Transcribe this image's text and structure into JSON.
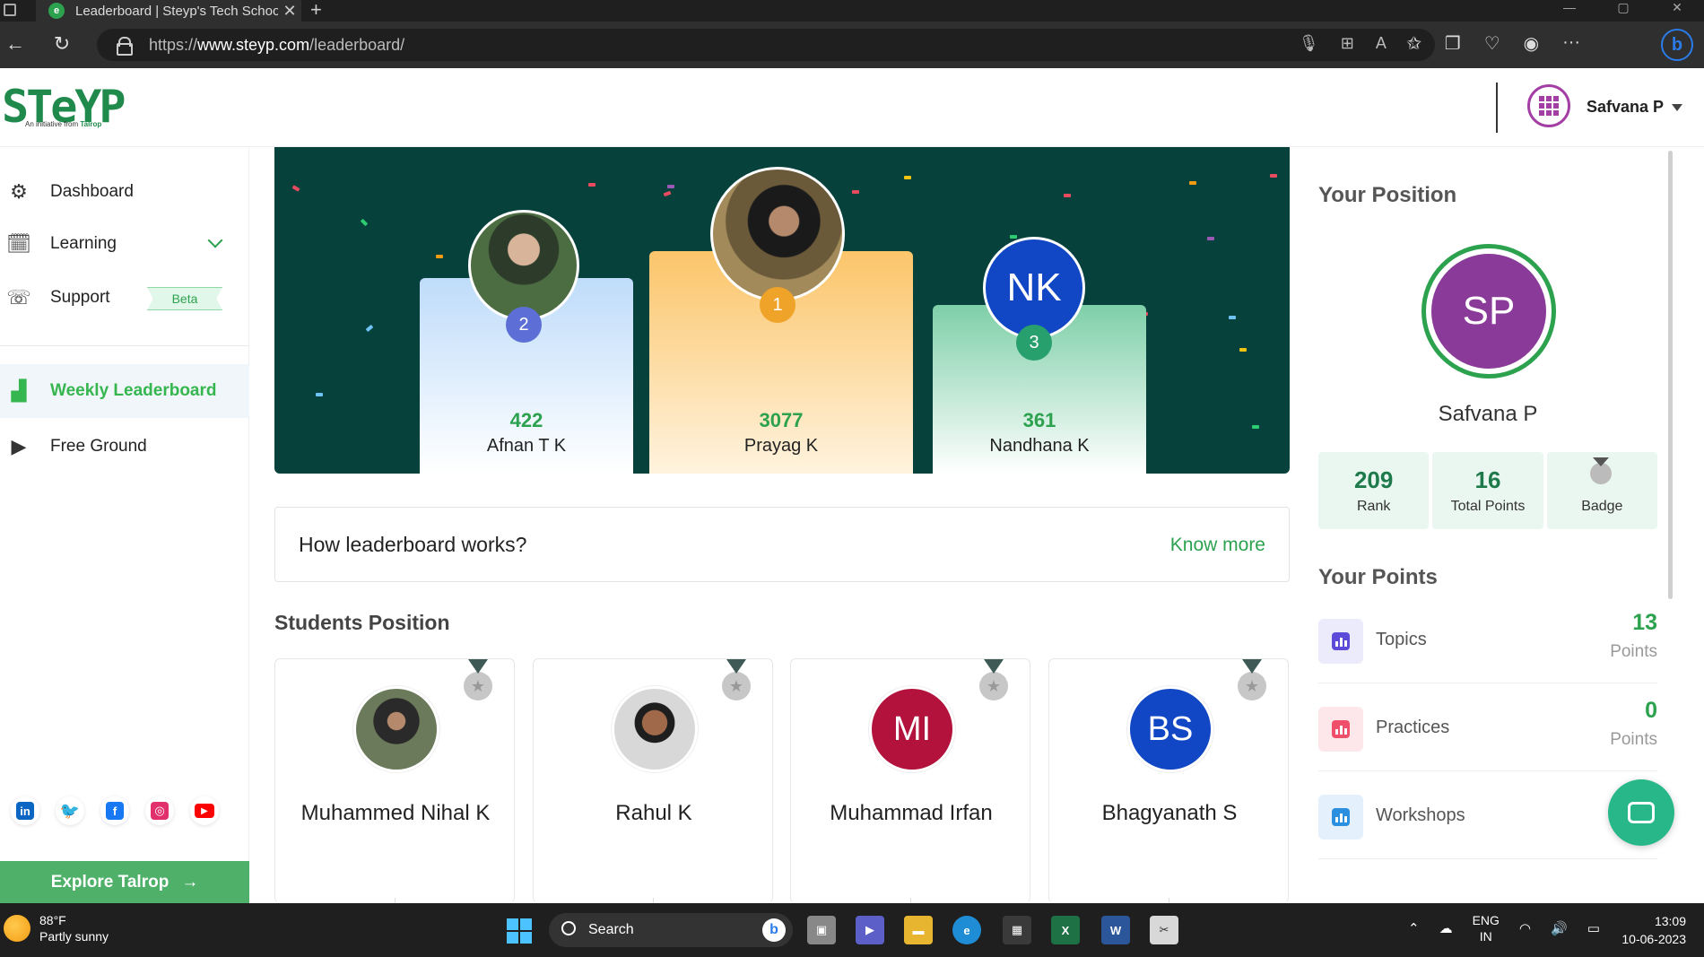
{
  "browser": {
    "tab_title": "Leaderboard | Steyp's Tech Schoo",
    "url_prefix": "https://",
    "url_domain": "www.steyp.com",
    "url_path": "/leaderboard/"
  },
  "header": {
    "logo_text": "STeYP",
    "logo_tagline": "An initiative from ",
    "logo_tagline_brand": "Talrop",
    "user_name": "Safvana P"
  },
  "sidebar": {
    "items": [
      {
        "label": "Dashboard",
        "icon": "dashboard-icon"
      },
      {
        "label": "Learning",
        "icon": "learning-icon"
      },
      {
        "label": "Support",
        "icon": "support-icon",
        "badge": "Beta"
      },
      {
        "label": "Weekly Leaderboard",
        "icon": "leaderboard-icon",
        "active": true
      },
      {
        "label": "Free Ground",
        "icon": "free-ground-icon"
      }
    ],
    "explore_label": "Explore Talrop",
    "socials": [
      "linkedin-icon",
      "twitter-icon",
      "facebook-icon",
      "instagram-icon",
      "youtube-icon"
    ]
  },
  "podium": {
    "first": {
      "rank": "1",
      "points": "3077",
      "name": "Prayag K"
    },
    "second": {
      "rank": "2",
      "points": "422",
      "name": "Afnan T K"
    },
    "third": {
      "rank": "3",
      "points": "361",
      "name": "Nandhana K",
      "initials": "NK"
    }
  },
  "how_it_works": {
    "title": "How leaderboard works?",
    "link": "Know more"
  },
  "students": {
    "title": "Students Position",
    "cards": [
      {
        "name": "Muhammed Nihal K",
        "initials": "",
        "color": "#6b7a5a"
      },
      {
        "name": "Rahul K",
        "initials": "",
        "color": "#c85a3a"
      },
      {
        "name": "Muhammad Irfan",
        "initials": "MI",
        "color": "#b3123d"
      },
      {
        "name": "Bhagyanath S",
        "initials": "BS",
        "color": "#1146c4"
      }
    ]
  },
  "your_position": {
    "title": "Your Position",
    "initials": "SP",
    "name": "Safvana P",
    "rank_value": "209",
    "rank_label": "Rank",
    "points_value": "16",
    "points_label": "Total Points",
    "badge_label": "Badge"
  },
  "your_points": {
    "title": "Your Points",
    "rows": [
      {
        "label": "Topics",
        "value": "13",
        "unit": "Points",
        "color": "#5b4bd8",
        "bg": "#ecebfb"
      },
      {
        "label": "Practices",
        "value": "0",
        "unit": "Points",
        "color": "#ef4f6a",
        "bg": "#fde7eb"
      },
      {
        "label": "Workshops",
        "value": "",
        "unit": "",
        "color": "#2b8fe0",
        "bg": "#e4f1fc"
      }
    ]
  },
  "taskbar": {
    "temp": "88°F",
    "weather": "Partly sunny",
    "search": "Search",
    "lang1": "ENG",
    "lang2": "IN",
    "time": "13:09",
    "date": "10-06-2023"
  },
  "colors": {
    "brand_green": "#2ca24f",
    "podium_bg": "#06413c",
    "gold": "#f0a329",
    "silver_blue": "#5d6fd6",
    "bronze_green": "#28a06d"
  }
}
